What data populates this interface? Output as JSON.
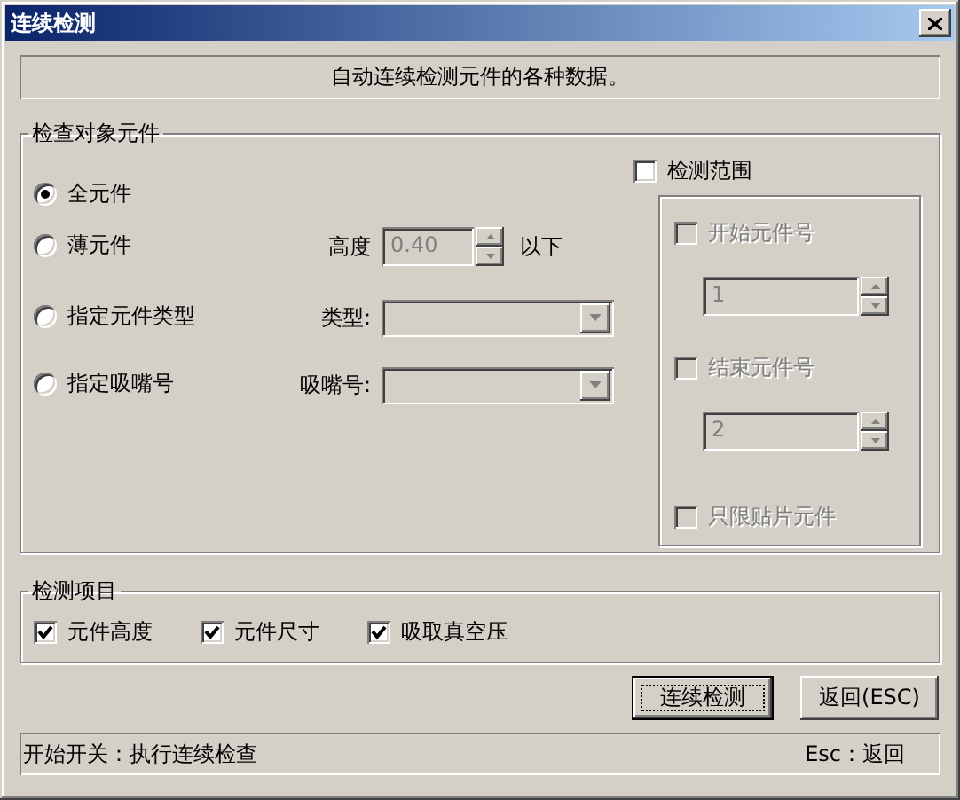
{
  "window": {
    "title": "连续检测"
  },
  "banner": "自动连续检测元件的各种数据。",
  "target_group": {
    "legend": "检查对象元件",
    "options": [
      {
        "label": "全元件",
        "selected": true
      },
      {
        "label": "薄元件",
        "selected": false,
        "field": {
          "kind": "spin",
          "label": "高度",
          "value": "0.40",
          "suffix": "以下",
          "disabled": true
        }
      },
      {
        "label": "指定元件类型",
        "selected": false,
        "field": {
          "kind": "combo",
          "label": "类型:",
          "disabled": true
        }
      },
      {
        "label": "指定吸嘴号",
        "selected": false,
        "field": {
          "kind": "combo",
          "label": "吸嘴号:",
          "disabled": true
        }
      }
    ],
    "range": {
      "label": "检测范围",
      "checked": false,
      "items": [
        {
          "kind": "check",
          "label": "开始元件号",
          "checked": false,
          "disabled": true
        },
        {
          "kind": "spin",
          "value": "1",
          "disabled": true
        },
        {
          "kind": "check",
          "label": "结束元件号",
          "checked": false,
          "disabled": true
        },
        {
          "kind": "spin",
          "value": "2",
          "disabled": true
        },
        {
          "kind": "check",
          "label": "只限贴片元件",
          "checked": false,
          "disabled": true
        }
      ]
    }
  },
  "items_group": {
    "legend": "检测项目",
    "items": [
      {
        "label": "元件高度",
        "checked": true
      },
      {
        "label": "元件尺寸",
        "checked": true
      },
      {
        "label": "吸取真空压",
        "checked": true
      }
    ]
  },
  "buttons": [
    {
      "label": "连续检测",
      "default": true
    },
    {
      "label": "返回(ESC)",
      "default": false
    }
  ],
  "status_bar": {
    "left": "开始开关：执行连续检查",
    "right": "Esc：返回"
  }
}
